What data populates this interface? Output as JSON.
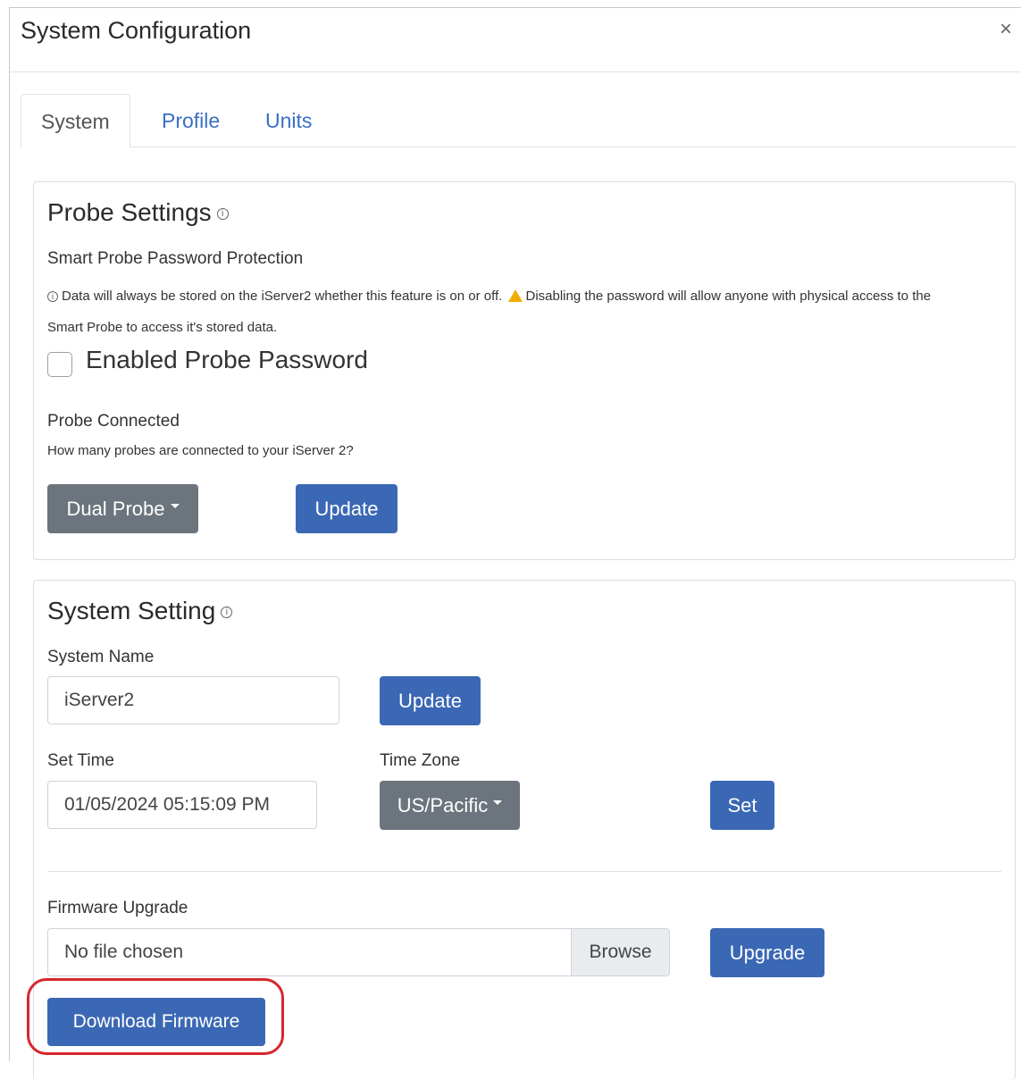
{
  "modal": {
    "title": "System Configuration",
    "close": "×"
  },
  "tabs": [
    {
      "label": "System",
      "active": true
    },
    {
      "label": "Profile",
      "active": false
    },
    {
      "label": "Units",
      "active": false
    }
  ],
  "probe_settings": {
    "title": "Probe Settings",
    "password_label": "Smart Probe Password Protection",
    "info_line1": "Data will always be stored on the iServer2 whether this feature is on or off.",
    "warning_text": "Disabling the password will allow anyone with physical access to the",
    "info_line2": "Smart Probe to access it's stored data.",
    "checkbox_label": "Enabled Probe Password",
    "checkbox_checked": false,
    "probe_connected_label": "Probe Connected",
    "probe_connected_help": "How many probes are connected to your iServer 2?",
    "probe_dropdown": "Dual Probe",
    "update_button": "Update"
  },
  "system_setting": {
    "title": "System Setting",
    "name_label": "System Name",
    "name_value": "iServer2",
    "name_update_button": "Update",
    "set_time_label": "Set Time",
    "time_value": "01/05/2024 05:15:09 PM",
    "time_zone_label": "Time Zone",
    "time_zone_value": "US/Pacific",
    "set_button": "Set",
    "firmware_label": "Firmware Upgrade",
    "file_value": "No file chosen",
    "browse_button": "Browse",
    "upgrade_button": "Upgrade",
    "download_button": "Download Firmware"
  },
  "colors": {
    "primary": "#3b68b5",
    "secondary": "#6c757d",
    "highlight": "#d7262e",
    "warning": "#f0ad00"
  },
  "icons": {
    "info": "info-circle-icon",
    "warning": "warning-triangle-icon",
    "close": "close-icon",
    "caret": "caret-down-icon"
  }
}
